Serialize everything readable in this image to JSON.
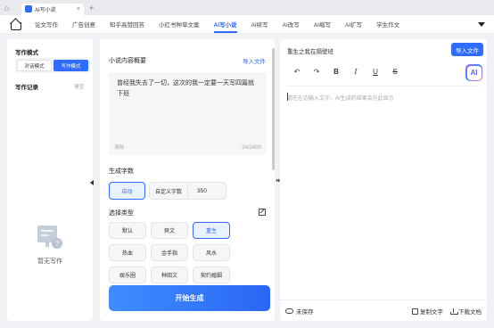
{
  "window": {
    "tab_title": "AI写小说"
  },
  "tabs": [
    {
      "label": "论文写作"
    },
    {
      "label": "广告创意"
    },
    {
      "label": "知乎高赞回答"
    },
    {
      "label": "小红书种草文案"
    },
    {
      "label": "AI写小说"
    },
    {
      "label": "AI续写"
    },
    {
      "label": "AI改写"
    },
    {
      "label": "AI缩写"
    },
    {
      "label": "AI扩写"
    },
    {
      "label": "学生作文"
    }
  ],
  "active_tab_index": 4,
  "sidebar": {
    "mode_title": "写作模式",
    "modes": [
      "对话模式",
      "写作模式"
    ],
    "active_mode": "写作模式",
    "records_title": "写作记录",
    "clear_label": "清空",
    "empty_text": "暂无写作"
  },
  "form": {
    "summary_label": "小说内容概要",
    "import_label": "导入文件",
    "summary_text": "曾经我失去了一切，这次的我一定要一天写四篇就下班",
    "clear_label": "清除",
    "char_count": "24/2400",
    "length_label": "生成字数",
    "length_auto": "自动",
    "length_custom_label": "自定义字数",
    "length_custom_value": "350",
    "type_label": "选择类型",
    "types": [
      "默认",
      "爽文",
      "重生",
      "热血",
      "金手指",
      "风水",
      "娱乐圈",
      "种田文",
      "契约婚姻"
    ],
    "selected_type": "重生",
    "generate_label": "开始生成"
  },
  "editor": {
    "doc_title": "重生之我在隔壁班",
    "import_label": "导入文件",
    "toolbar": [
      "↶",
      "↷",
      "B",
      "I",
      "U",
      "S"
    ],
    "ai_label": "AI",
    "placeholder": "请在左边输入文字，AI生成的结果会在此显示",
    "save_state": "未保存",
    "copy_label": "复制文字",
    "download_label": "下载文档"
  },
  "colors": {
    "accent": "#2f6bff",
    "background": "#f1f2f5"
  }
}
